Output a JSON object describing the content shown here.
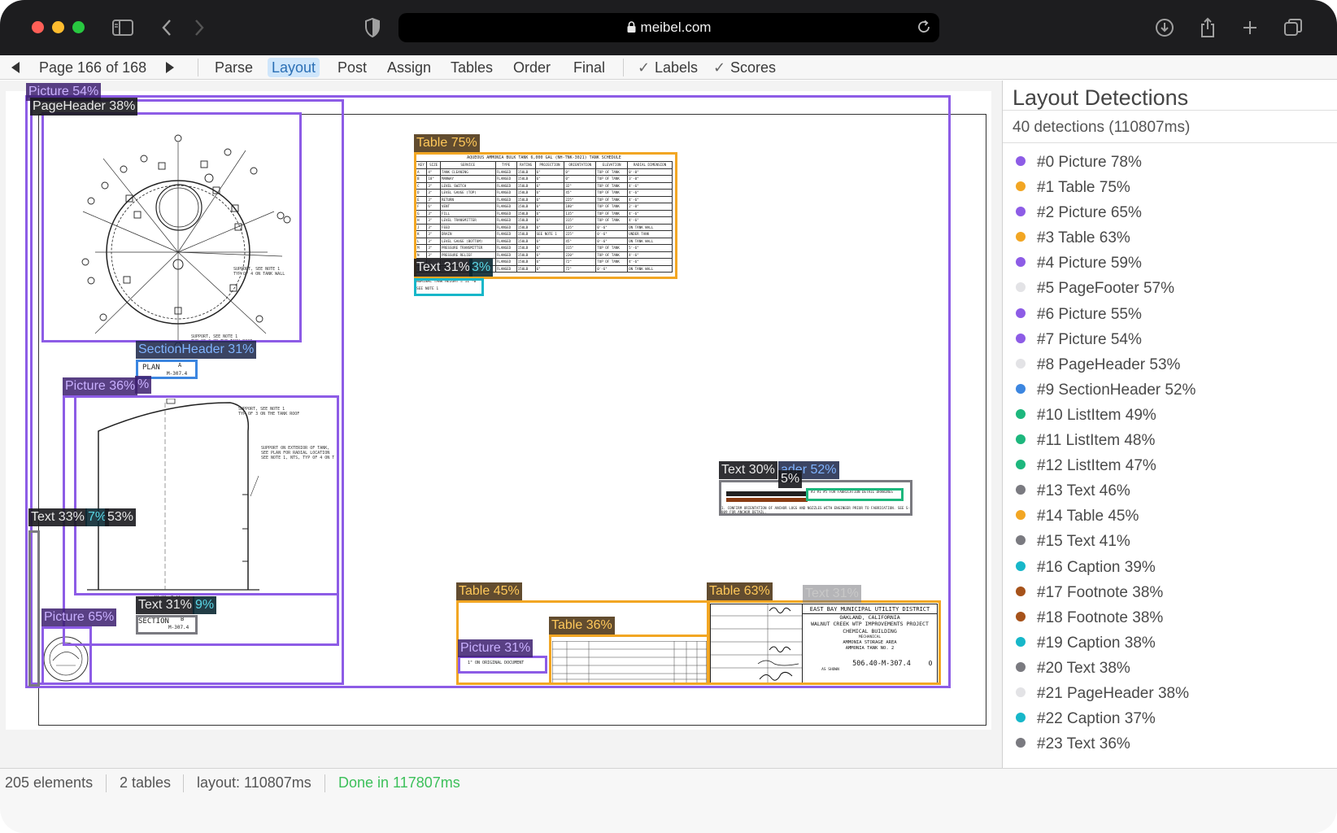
{
  "browser": {
    "url": "meibel.com"
  },
  "toolbar": {
    "page_label": "Page 166 of 168",
    "tabs": [
      "Parse",
      "Layout",
      "Post",
      "Assign",
      "Tables",
      "Order",
      "Final"
    ],
    "active_tab": "Layout",
    "toggles": [
      {
        "label": "Labels",
        "checked": true
      },
      {
        "label": "Scores",
        "checked": true
      }
    ]
  },
  "canvas": {
    "overlay_labels": [
      "Picture 54%",
      "PageHeader 38%",
      "Table 75%",
      "Text 31%",
      "3%",
      "SectionHeader 31%",
      "Picture 36%",
      "%",
      "Text 33%",
      "7%",
      "53%",
      "Text 31%",
      "9%",
      "Picture 65%",
      "Table 45%",
      "Table 36%",
      "Picture 31%",
      "Table 63%",
      "Text 31%",
      "Text 30%",
      "ader 52%",
      "5%"
    ],
    "drawing_text": {
      "plan_label": "PLAN",
      "plan_ref": "A",
      "plan_sheet": "M-307.4",
      "section_label": "SECTION",
      "section_ref": "B",
      "section_sheet": "M-307.4",
      "table_title": "AQUEOUS AMMONIA BULK TANK 6,000 GAL (NH-TNK-3021) TANK SCHEDULE",
      "table_headers": [
        "KEY",
        "SIZE",
        "SERVICE",
        "TYPE",
        "RATING",
        "PROJECTION",
        "ORIENTATION",
        "ELEVATION",
        "RADIAL DIMENSION"
      ],
      "table_rows": [
        [
          "A",
          "4\"",
          "TANK CLEANING",
          "FLANGED",
          "150LB",
          "6\"",
          "0°",
          "TOP OF TANK",
          "0'-0\""
        ],
        [
          "B",
          "18\"",
          "MANWAY",
          "FLANGED",
          "150LB",
          "6\"",
          "0°",
          "TOP OF TANK",
          "3'-0\""
        ],
        [
          "C",
          "3\"",
          "LEVEL SWITCH",
          "FLANGED",
          "150LB",
          "6\"",
          "32°",
          "TOP OF TANK",
          "4'-6\""
        ],
        [
          "D",
          "3\"",
          "LEVEL GAUGE (TOP)",
          "FLANGED",
          "150LB",
          "6\"",
          "45°",
          "TOP OF TANK",
          "4'-6\""
        ],
        [
          "E",
          "3\"",
          "RETURN",
          "FLANGED",
          "150LB",
          "6\"",
          "225°",
          "TOP OF TANK",
          "4'-6\""
        ],
        [
          "F",
          "6\"",
          "VENT",
          "FLANGED",
          "150LB",
          "6\"",
          "180°",
          "TOP OF TANK",
          "2'-0\""
        ],
        [
          "G",
          "3\"",
          "FILL",
          "FLANGED",
          "150LB",
          "6\"",
          "135°",
          "TOP OF TANK",
          "4'-6\""
        ],
        [
          "H",
          "3\"",
          "LEVEL TRANSMITTER",
          "FLANGED",
          "150LB",
          "6\"",
          "315°",
          "TOP OF TANK",
          "4'-6\""
        ],
        [
          "J",
          "3\"",
          "FEED",
          "FLANGED",
          "150LB",
          "6\"",
          "135°",
          "0'-6\"",
          "ON TANK WALL"
        ],
        [
          "K",
          "3\"",
          "DRAIN",
          "FLANGED",
          "150LB",
          "SEE NOTE 1",
          "225°",
          "0'-6\"",
          "UNDER TANK"
        ],
        [
          "L",
          "3\"",
          "LEVEL GAUGE (BOTTOM)",
          "FLANGED",
          "150LB",
          "6\"",
          "45°",
          "0'-6\"",
          "ON TANK WALL"
        ],
        [
          "M",
          "3\"",
          "PRESSURE TRANSMITTER",
          "FLANGED",
          "150LB",
          "6\"",
          "315°",
          "TOP OF TANK",
          "5'-6\""
        ],
        [
          "N",
          "3\"",
          "PRESSURE RELIEF",
          "FLANGED",
          "150LB",
          "6\"",
          "220°",
          "TOP OF TANK",
          "4'-6\""
        ],
        [
          "P",
          "3\"",
          "SPARE",
          "FLANGED",
          "150LB",
          "6\"",
          "72°",
          "TOP OF TANK",
          "4'-6\""
        ],
        [
          "Q",
          "3\"",
          "SPARE",
          "FLANGED",
          "150LB",
          "6\"",
          "72°",
          "0'-6\"",
          "ON TANK WALL"
        ]
      ],
      "nominal_height": "NOMINAL TANK HEIGHT = 11'-0\"",
      "see_note": "SEE NOTE 1",
      "note_fabrication": "#3 #1 #5 FOR FABRICATION DETAIL DRAWINGS",
      "note_confirm": "1. CONFIRM ORIENTATION OF ANCHOR LUGS AND NOZZLES WITH ENGINEER PRIOR TO FABRICATION. SEE S-809 FOR ANCHOR DETAIL.",
      "title_block": {
        "district": "EAST BAY MUNICIPAL UTILITY DISTRICT",
        "city": "OAKLAND, CALIFORNIA",
        "project": "WALNUT CREEK WTP IMPROVEMENTS PROJECT",
        "building": "CHEMICAL BUILDING",
        "discipline": "MECHANICAL",
        "sheet_title_1": "AMMONIA STORAGE AREA",
        "sheet_title_2": "AMMONIA TANK NO. 2",
        "drawing_no": "506.40-M-307.4",
        "rev": "0",
        "scale": "AS SHOWN",
        "original_note": "1\" ON ORIGINAL DOCUMENT"
      }
    }
  },
  "side_panel": {
    "title": "Layout Detections",
    "summary": "40 detections (110807ms)",
    "detections": [
      {
        "label": "#0 Picture 78%",
        "color": "#8d5ce6"
      },
      {
        "label": "#1 Table 75%",
        "color": "#f2a623"
      },
      {
        "label": "#2 Picture 65%",
        "color": "#8d5ce6"
      },
      {
        "label": "#3 Table 63%",
        "color": "#f2a623"
      },
      {
        "label": "#4 Picture 59%",
        "color": "#8d5ce6"
      },
      {
        "label": "#5 PageFooter 57%",
        "color": "#e3e3e6"
      },
      {
        "label": "#6 Picture 55%",
        "color": "#8d5ce6"
      },
      {
        "label": "#7 Picture 54%",
        "color": "#8d5ce6"
      },
      {
        "label": "#8 PageHeader 53%",
        "color": "#e3e3e6"
      },
      {
        "label": "#9 SectionHeader 52%",
        "color": "#3c86e0"
      },
      {
        "label": "#10 ListItem 49%",
        "color": "#1db77d"
      },
      {
        "label": "#11 ListItem 48%",
        "color": "#1db77d"
      },
      {
        "label": "#12 ListItem 47%",
        "color": "#1db77d"
      },
      {
        "label": "#13 Text 46%",
        "color": "#7a7a80"
      },
      {
        "label": "#14 Table 45%",
        "color": "#f2a623"
      },
      {
        "label": "#15 Text 41%",
        "color": "#7a7a80"
      },
      {
        "label": "#16 Caption 39%",
        "color": "#17b7c9"
      },
      {
        "label": "#17 Footnote 38%",
        "color": "#a6521a"
      },
      {
        "label": "#18 Footnote 38%",
        "color": "#a6521a"
      },
      {
        "label": "#19 Caption 38%",
        "color": "#17b7c9"
      },
      {
        "label": "#20 Text 38%",
        "color": "#7a7a80"
      },
      {
        "label": "#21 PageHeader 38%",
        "color": "#e3e3e6"
      },
      {
        "label": "#22 Caption 37%",
        "color": "#17b7c9"
      },
      {
        "label": "#23 Text 36%",
        "color": "#7a7a80"
      }
    ]
  },
  "status_bar": {
    "elements": "205 elements",
    "tables": "2 tables",
    "layout_time": "layout: 110807ms",
    "done": "Done in 117807ms",
    "done_color": "#3cc05a"
  }
}
